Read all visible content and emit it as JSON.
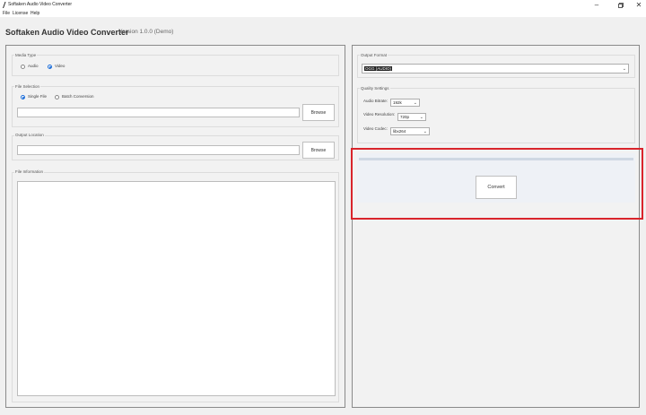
{
  "window": {
    "title": "Softaken Audio Video Converter",
    "minimize_icon": "minimize-icon",
    "maximize_icon": "maximize-icon",
    "close_icon": "close-icon"
  },
  "menu": {
    "items": [
      "File",
      "License",
      "Help"
    ]
  },
  "header": {
    "app_title": "Softaken Audio Video Converter",
    "version": "Version 1.0.0 (Demo)"
  },
  "media_type": {
    "label": "Media Type",
    "options": [
      "Audio",
      "Video"
    ],
    "selected": "Video"
  },
  "file_selection": {
    "label": "File Selection",
    "options": [
      "Single File",
      "Batch Conversion"
    ],
    "selected": "Single File",
    "path_value": "",
    "browse_label": "Browse"
  },
  "output_location": {
    "label": "Output Location",
    "path_value": "",
    "browse_label": "Browse"
  },
  "file_information": {
    "label": "File Information",
    "content": ""
  },
  "output_format": {
    "label": "Output Format",
    "selected": "OGG (AUDIO)"
  },
  "quality_settings": {
    "label": "Quality Settings",
    "audio_bitrate": {
      "label": "Audio Bitrate:",
      "value": "192k"
    },
    "video_resolution": {
      "label": "Video Resolution:",
      "value": "720p"
    },
    "video_codec": {
      "label": "Video Codec:",
      "value": "libx264"
    }
  },
  "convert": {
    "label": "Convert",
    "progress": 0
  },
  "colors": {
    "highlight": "#d9242b",
    "radio_accent": "#1e6fd9",
    "progress_track": "#cfd8e3"
  }
}
